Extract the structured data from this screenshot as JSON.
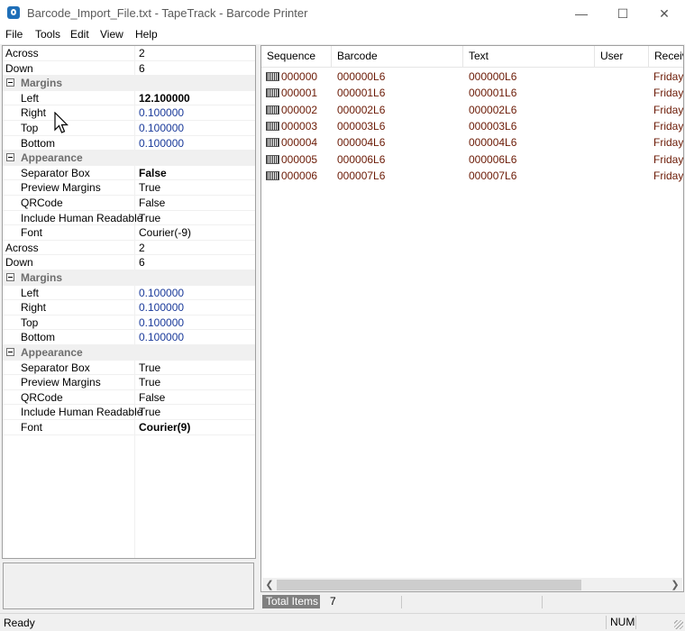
{
  "window": {
    "title": "Barcode_Import_File.txt - TapeTrack - Barcode Printer"
  },
  "menu": [
    "File",
    "Tools",
    "Edit",
    "View",
    "Help"
  ],
  "properties": [
    {
      "type": "prop",
      "name": "Across",
      "value": "2"
    },
    {
      "type": "prop",
      "name": "Down",
      "value": "6"
    },
    {
      "type": "cat",
      "name": "Margins"
    },
    {
      "type": "sub",
      "name": "Left",
      "value": "12.100000",
      "bold": true
    },
    {
      "type": "sub",
      "name": "Right",
      "value": "0.100000",
      "num": true
    },
    {
      "type": "sub",
      "name": "Top",
      "value": "0.100000",
      "num": true
    },
    {
      "type": "sub",
      "name": "Bottom",
      "value": "0.100000",
      "num": true
    },
    {
      "type": "cat",
      "name": "Appearance"
    },
    {
      "type": "sub",
      "name": "Separator Box",
      "value": "False",
      "bold": true
    },
    {
      "type": "sub",
      "name": "Preview Margins",
      "value": "True"
    },
    {
      "type": "sub",
      "name": "QRCode",
      "value": "False"
    },
    {
      "type": "sub",
      "name": "Include Human Readable",
      "value": "True"
    },
    {
      "type": "sub",
      "name": "Font",
      "value": "Courier(-9)"
    },
    {
      "type": "prop",
      "name": "Across",
      "value": "2"
    },
    {
      "type": "prop",
      "name": "Down",
      "value": "6"
    },
    {
      "type": "cat",
      "name": "Margins"
    },
    {
      "type": "sub",
      "name": "Left",
      "value": "0.100000",
      "num": true
    },
    {
      "type": "sub",
      "name": "Right",
      "value": "0.100000",
      "num": true
    },
    {
      "type": "sub",
      "name": "Top",
      "value": "0.100000",
      "num": true
    },
    {
      "type": "sub",
      "name": "Bottom",
      "value": "0.100000",
      "num": true
    },
    {
      "type": "cat",
      "name": "Appearance"
    },
    {
      "type": "sub",
      "name": "Separator Box",
      "value": "True"
    },
    {
      "type": "sub",
      "name": "Preview Margins",
      "value": "True"
    },
    {
      "type": "sub",
      "name": "QRCode",
      "value": "False"
    },
    {
      "type": "sub",
      "name": "Include Human Readable",
      "value": "True"
    },
    {
      "type": "sub",
      "name": "Font",
      "value": "Courier(9)",
      "bold": true
    }
  ],
  "list": {
    "columns": [
      "Sequence",
      "Barcode",
      "Text",
      "User",
      "Received"
    ],
    "rows": [
      [
        "000000",
        "000000L6",
        "000000L6",
        "",
        "Friday"
      ],
      [
        "000001",
        "000001L6",
        "000001L6",
        "",
        "Friday"
      ],
      [
        "000002",
        "000002L6",
        "000002L6",
        "",
        "Friday"
      ],
      [
        "000003",
        "000003L6",
        "000003L6",
        "",
        "Friday"
      ],
      [
        "000004",
        "000004L6",
        "000004L6",
        "",
        "Friday"
      ],
      [
        "000005",
        "000006L6",
        "000006L6",
        "",
        "Friday"
      ],
      [
        "000006",
        "000007L6",
        "000007L6",
        "",
        "Friday"
      ]
    ]
  },
  "totals": {
    "label": "Total Items",
    "value": "7"
  },
  "status": {
    "text": "Ready",
    "num": "NUM"
  }
}
